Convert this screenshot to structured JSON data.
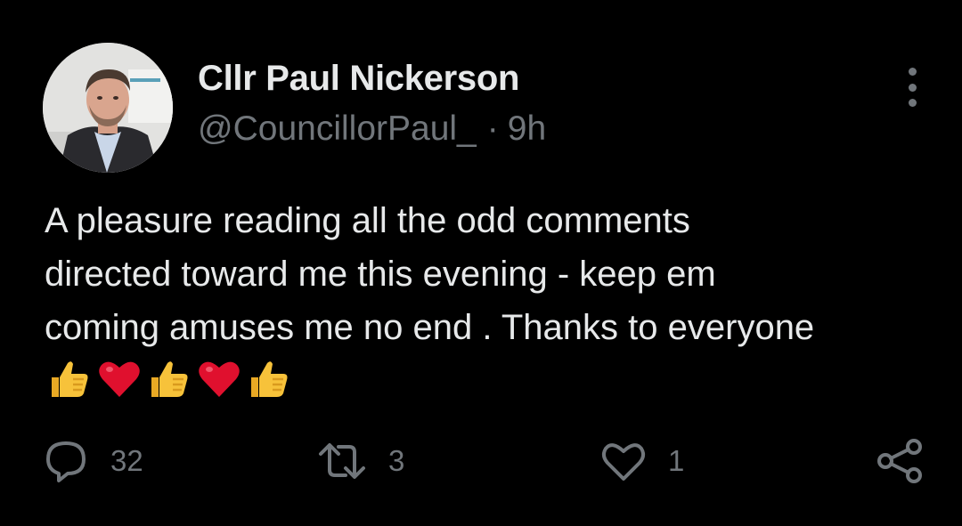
{
  "author": {
    "name": "Cllr Paul Nickerson",
    "handle": "@CouncillorPaul_",
    "separator": "·",
    "time": "9h"
  },
  "tweet": {
    "text": "A pleasure reading all the odd comments\ndirected toward me this evening - keep em\ncoming amuses me no end . Thanks to everyone",
    "emojis": [
      "thumbs-up",
      "red-heart",
      "thumbs-up",
      "red-heart",
      "thumbs-up"
    ]
  },
  "actions": {
    "replies": "32",
    "retweets": "3",
    "likes": "1"
  },
  "icons": {
    "reply": "reply-icon",
    "retweet": "retweet-icon",
    "like": "heart-icon",
    "share": "share-icon",
    "more": "more-vertical-icon"
  },
  "colors": {
    "background": "#000000",
    "primary_text": "#e7e9ea",
    "secondary_text": "#71767b",
    "heart_emoji": "#e0102e",
    "thumb_emoji": "#f7c23a"
  }
}
